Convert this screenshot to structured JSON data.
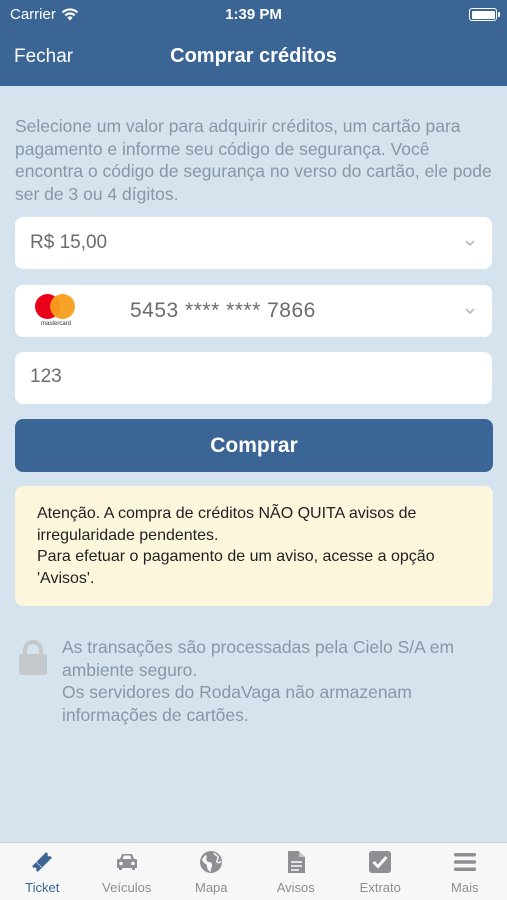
{
  "status_bar": {
    "carrier": "Carrier",
    "time": "1:39 PM"
  },
  "nav": {
    "close_label": "Fechar",
    "title": "Comprar créditos"
  },
  "intro_text": "Selecione um valor para adquirir créditos, um cartão para pagamento e informe seu código de segurança. Você encontra o código de segurança no verso do cartão, ele pode ser de 3 ou 4 dígitos.",
  "amount": {
    "value": "R$ 15,00"
  },
  "card": {
    "brand_label": "mastercard",
    "number": "5453 **** ****  7866"
  },
  "cvv": {
    "value": "123"
  },
  "buy_button_label": "Comprar",
  "warning": {
    "line1": "Atenção. A compra de créditos NÃO QUITA avisos de irregularidade pendentes.",
    "line2": "Para efetuar o pagamento de um aviso, acesse a opção 'Avisos'."
  },
  "secure": {
    "line1": "As transações são processadas pela Cielo S/A em ambiente seguro.",
    "line2": "Os servidores do RodaVaga não armazenam informações de cartões."
  },
  "tabs": [
    {
      "label": "Ticket",
      "icon": "ticket-icon",
      "active": true
    },
    {
      "label": "Veículos",
      "icon": "car-icon",
      "active": false
    },
    {
      "label": "Mapa",
      "icon": "globe-icon",
      "active": false
    },
    {
      "label": "Avisos",
      "icon": "document-icon",
      "active": false
    },
    {
      "label": "Extrato",
      "icon": "checkbox-icon",
      "active": false
    },
    {
      "label": "Mais",
      "icon": "menu-icon",
      "active": false
    }
  ],
  "colors": {
    "primary": "#3a6594",
    "background": "#d4e3ee",
    "warning_bg": "#fcf6dd",
    "muted_text": "#8797a6"
  }
}
